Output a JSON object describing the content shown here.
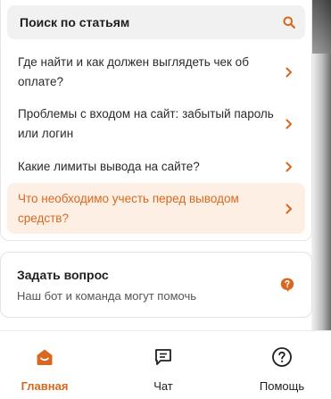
{
  "colors": {
    "accent": "#d8681f",
    "active_bg": "#fdefe3",
    "search_bg": "#f1f1f1",
    "text": "#1f1f1f"
  },
  "search": {
    "label": "Поиск по статьям",
    "icon": "search-icon"
  },
  "articles": [
    {
      "text": "Где найти и как должен выглядеть чек об оплате?",
      "active": false
    },
    {
      "text": "Проблемы с входом на сайт: забытый пароль или логин",
      "active": false
    },
    {
      "text": "Какие лимиты вывода на сайте?",
      "active": false
    },
    {
      "text": "Что необходимо учесть перед выводом средств?",
      "active": true
    }
  ],
  "ask": {
    "title": "Задать вопрос",
    "subtitle": "Наш бот и команда могут помочь",
    "icon": "question-bubble-icon"
  },
  "tabs": [
    {
      "label": "Главная",
      "icon": "home-icon",
      "active": true
    },
    {
      "label": "Чат",
      "icon": "chat-icon",
      "active": false
    },
    {
      "label": "Помощь",
      "icon": "help-icon",
      "active": false
    }
  ]
}
